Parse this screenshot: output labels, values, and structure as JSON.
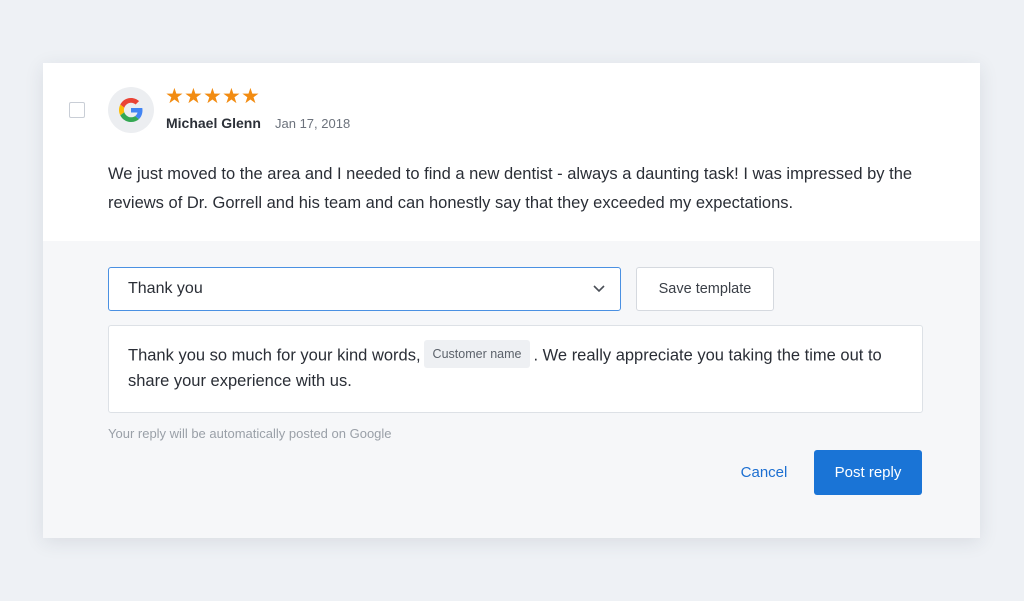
{
  "review": {
    "rating": 5,
    "rating_max": 5,
    "star_glyph": "★",
    "star_color": "#f28c12",
    "avatar_icon": "google-icon",
    "author": "Michael Glenn",
    "date": "Jan 17, 2018",
    "text": "We just moved to the area and I needed to find a new dentist - always a daunting task! I was impressed by the reviews of Dr. Gorrell and his team and can honestly say that they exceeded my expectations."
  },
  "reply": {
    "template_select": {
      "value": "Thank you",
      "icon": "chevron-down-icon"
    },
    "save_template_label": "Save template",
    "message": {
      "before_token": "Thank you so much for your kind words,",
      "token": "Customer name",
      "after_token": ". We really appreciate you taking the time out to share your experience with us."
    },
    "hint": "Your reply will be automatically posted on Google",
    "cancel_label": "Cancel",
    "post_label": "Post reply"
  },
  "colors": {
    "accent": "#1a74d6",
    "link": "#1c6fd1",
    "select_border": "#4a90e2"
  }
}
